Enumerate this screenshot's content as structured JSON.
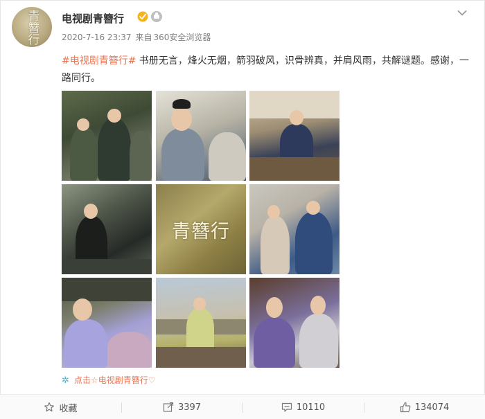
{
  "post": {
    "avatar_text": "青簪行",
    "username": "电视剧青簪行",
    "timestamp": "2020-7-16 23:37",
    "source_label": "来自",
    "source_name": "360安全浏览器",
    "hashtag": "#电视剧青簪行#",
    "body": " 书册无言，烽火无烟，箭羽破风，识骨辨真，并肩风雨，共解谜题。感谢，一路同行。",
    "images": [
      {
        "label": "剧照1"
      },
      {
        "label": "剧照2"
      },
      {
        "label": "剧照3"
      },
      {
        "label": "剧照4"
      },
      {
        "label": "青簪行"
      },
      {
        "label": "剧照6"
      },
      {
        "label": "剧照7"
      },
      {
        "label": "剧照8"
      },
      {
        "label": "剧照9"
      }
    ],
    "title_image_text": "青簪行",
    "link_text": "点击☆电视剧青簪行♡"
  },
  "actions": {
    "favorite_label": "收藏",
    "repost_count": "3397",
    "comment_count": "10110",
    "like_count": "134074"
  },
  "colors": {
    "hashtag": "#eb7350",
    "verified": "#f8b21c",
    "link_sparkle": "#5ab2c9"
  },
  "icons": [
    "verified-icon",
    "member-badge-icon",
    "chevron-down-icon",
    "star-icon",
    "repost-icon",
    "comment-icon",
    "thumbs-up-icon",
    "sparkle-icon"
  ]
}
